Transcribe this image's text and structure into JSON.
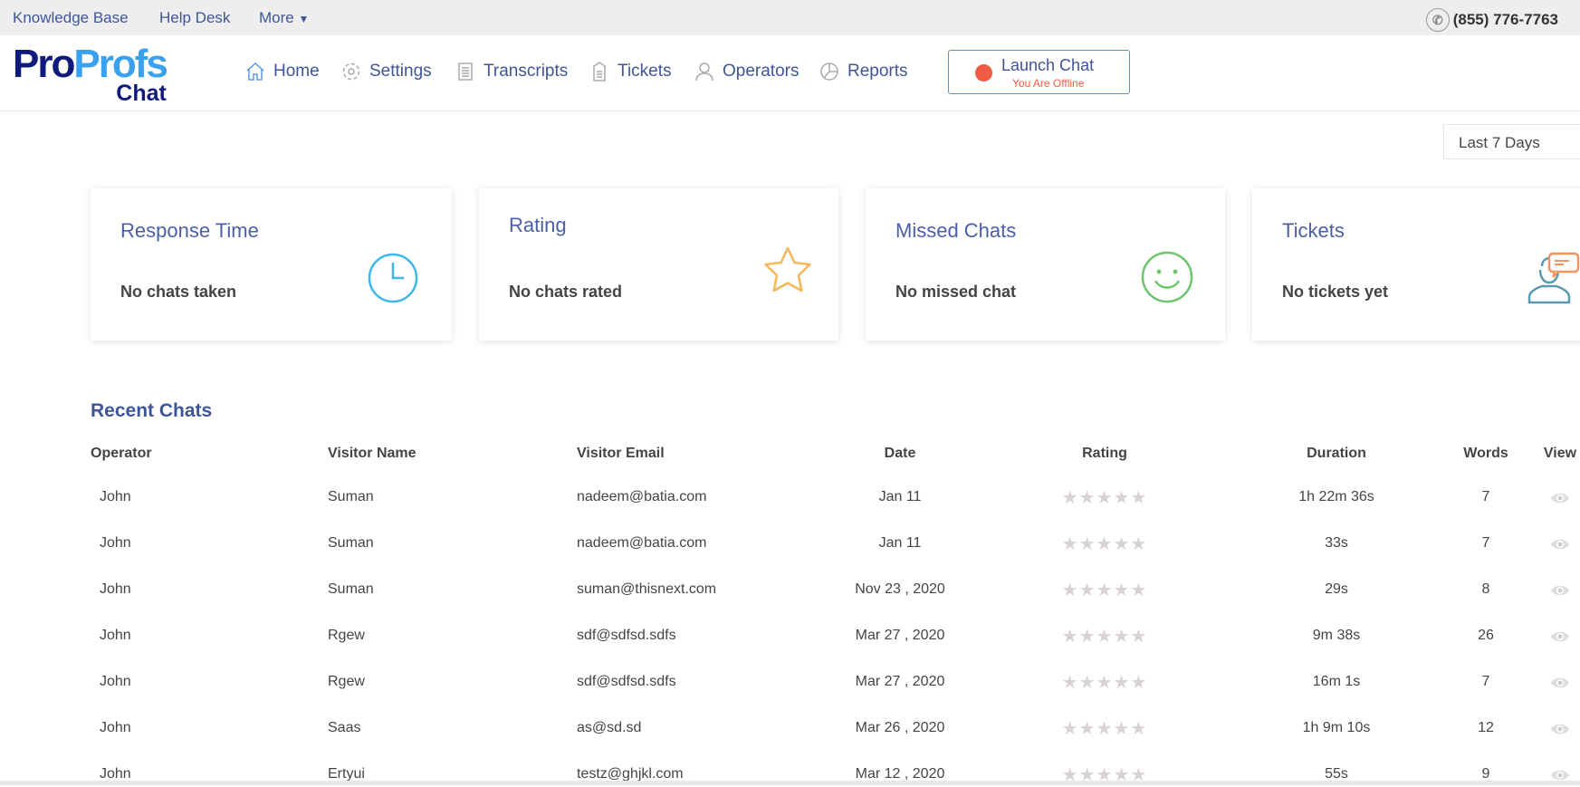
{
  "topbar": {
    "links": [
      "Knowledge Base",
      "Help Desk",
      "More"
    ],
    "phone": "(855) 776-7763"
  },
  "logo": {
    "pro": "Pro",
    "profs": "Profs",
    "chat": "Chat"
  },
  "nav": [
    {
      "label": "Home",
      "icon": "home-icon"
    },
    {
      "label": "Settings",
      "icon": "gear-icon"
    },
    {
      "label": "Transcripts",
      "icon": "document-icon"
    },
    {
      "label": "Tickets",
      "icon": "ticket-icon"
    },
    {
      "label": "Operators",
      "icon": "user-icon"
    },
    {
      "label": "Reports",
      "icon": "pie-chart-icon"
    }
  ],
  "launch": {
    "label": "Launch Chat",
    "status": "You Are Offline",
    "status_color": "#ef5b43"
  },
  "range": "Last 7 Days",
  "cards": [
    {
      "title": "Response Time",
      "text": "No chats taken",
      "icon": "clock-icon"
    },
    {
      "title": "Rating",
      "text": "No chats rated",
      "icon": "star-icon"
    },
    {
      "title": "Missed Chats",
      "text": "No missed chat",
      "icon": "smiley-icon"
    },
    {
      "title": "Tickets",
      "text": "No tickets yet",
      "icon": "support-agent-icon"
    }
  ],
  "recent": {
    "title": "Recent Chats",
    "headers": [
      "Operator",
      "Visitor Name",
      "Visitor Email",
      "Date",
      "Rating",
      "Duration",
      "Words",
      "View"
    ],
    "rows": [
      {
        "operator": "John",
        "name": "Suman",
        "email": "nadeem@batia.com",
        "date": "Jan 11",
        "rating": 0,
        "duration": "1h 22m 36s",
        "words": "7"
      },
      {
        "operator": "John",
        "name": "Suman",
        "email": "nadeem@batia.com",
        "date": "Jan 11",
        "rating": 0,
        "duration": "33s",
        "words": "7"
      },
      {
        "operator": "John",
        "name": "Suman",
        "email": "suman@thisnext.com",
        "date": "Nov 23 , 2020",
        "rating": 0,
        "duration": "29s",
        "words": "8"
      },
      {
        "operator": "John",
        "name": "Rgew",
        "email": "sdf@sdfsd.sdfs",
        "date": "Mar 27 , 2020",
        "rating": 0,
        "duration": "9m 38s",
        "words": "26"
      },
      {
        "operator": "John",
        "name": "Rgew",
        "email": "sdf@sdfsd.sdfs",
        "date": "Mar 27 , 2020",
        "rating": 0,
        "duration": "16m 1s",
        "words": "7"
      },
      {
        "operator": "John",
        "name": "Saas",
        "email": "as@sd.sd",
        "date": "Mar 26 , 2020",
        "rating": 0,
        "duration": "1h 9m 10s",
        "words": "12"
      },
      {
        "operator": "John",
        "name": "Ertyui",
        "email": "testz@ghjkl.com",
        "date": "Mar 12 , 2020",
        "rating": 0,
        "duration": "55s",
        "words": "9"
      }
    ]
  }
}
